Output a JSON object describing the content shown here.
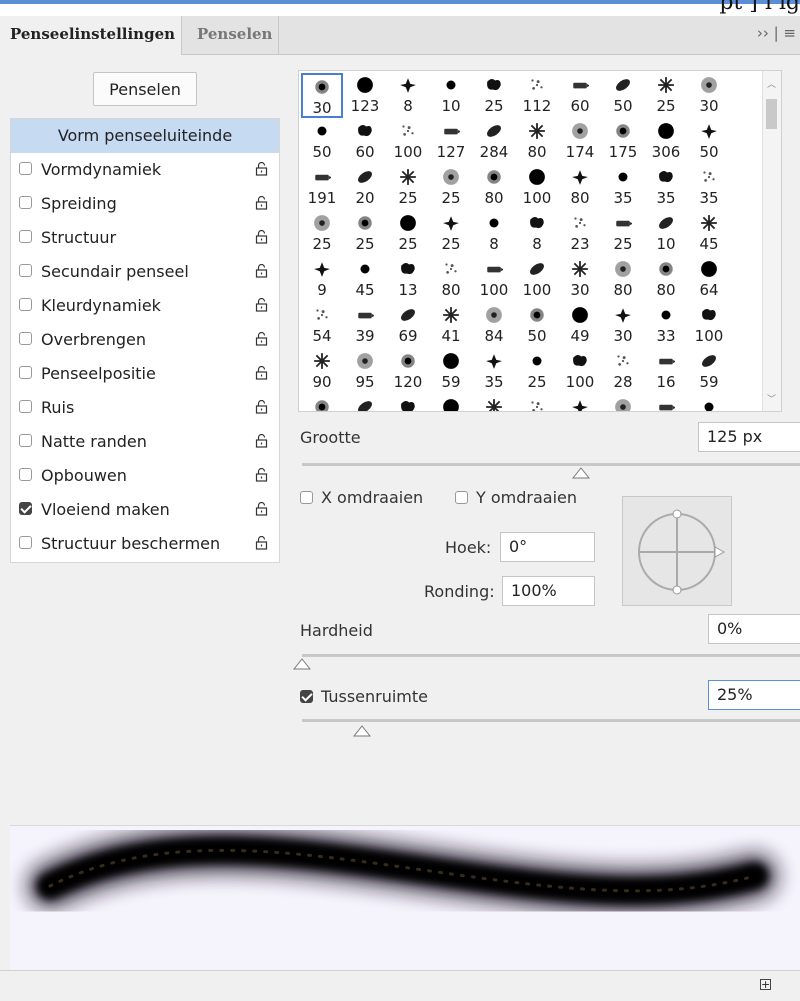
{
  "window": {
    "caption_fragment": "pt ]  i  ig",
    "menu_glyph": "›› | ≡"
  },
  "tabs": [
    {
      "label": "Penseelinstellingen",
      "active": true
    },
    {
      "label": "Penselen",
      "active": false
    }
  ],
  "penselen_button": "Penselen",
  "sidebar": {
    "header": "Vorm penseeluiteinde",
    "items": [
      {
        "label": "Vormdynamiek",
        "checked": false
      },
      {
        "label": "Spreiding",
        "checked": false
      },
      {
        "label": "Structuur",
        "checked": false
      },
      {
        "label": "Secundair penseel",
        "checked": false
      },
      {
        "label": "Kleurdynamiek",
        "checked": false
      },
      {
        "label": "Overbrengen",
        "checked": false
      },
      {
        "label": "Penseelpositie",
        "checked": false
      },
      {
        "label": "Ruis",
        "checked": false
      },
      {
        "label": "Natte randen",
        "checked": false
      },
      {
        "label": "Opbouwen",
        "checked": false
      },
      {
        "label": "Vloeiend maken",
        "checked": true
      },
      {
        "label": "Structuur beschermen",
        "checked": false
      }
    ]
  },
  "brush_presets": {
    "selected_index": 0,
    "rows": [
      [
        "30",
        "123",
        "8",
        "10",
        "25",
        "112",
        "60",
        "50",
        "25",
        "30"
      ],
      [
        "50",
        "60",
        "100",
        "127",
        "284",
        "80",
        "174",
        "175",
        "306",
        "50"
      ],
      [
        "191",
        "20",
        "25",
        "25",
        "80",
        "100",
        "80",
        "35",
        "35",
        "35"
      ],
      [
        "25",
        "25",
        "25",
        "25",
        "8",
        "8",
        "23",
        "25",
        "10",
        "45"
      ],
      [
        "9",
        "45",
        "13",
        "80",
        "100",
        "100",
        "30",
        "80",
        "80",
        "64"
      ],
      [
        "54",
        "39",
        "69",
        "41",
        "84",
        "50",
        "49",
        "30",
        "33",
        "100"
      ],
      [
        "90",
        "95",
        "120",
        "59",
        "35",
        "25",
        "100",
        "28",
        "16",
        "59"
      ]
    ]
  },
  "settings": {
    "grootte_label": "Grootte",
    "grootte_value": "125 px",
    "grootte_slider": 0.56,
    "flip_x_label": "X omdraaien",
    "flip_y_label": "Y omdraaien",
    "hoek_label": "Hoek:",
    "hoek_value": "0°",
    "ronding_label": "Ronding:",
    "ronding_value": "100%",
    "hardheid_label": "Hardheid",
    "hardheid_value": "0%",
    "hardheid_slider": 0.0,
    "tussenruimte_label": "Tussenruimte",
    "tussenruimte_value": "25%",
    "tussenruimte_checked": true,
    "tussenruimte_slider": 0.12
  },
  "accent_color": "#5a8fd8"
}
